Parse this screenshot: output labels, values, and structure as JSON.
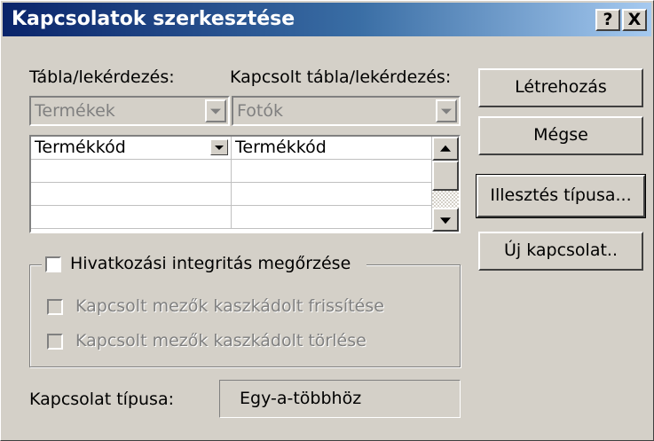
{
  "window": {
    "title": "Kapcsolatok szerkesztése",
    "help_button": "?",
    "close_button": "X"
  },
  "labels": {
    "table_query": "Tábla/lekérdezés:",
    "related_table_query": "Kapcsolt tábla/lekérdezés:",
    "relationship_type": "Kapcsolat típusa:"
  },
  "combos": {
    "table": {
      "value": "Termékek",
      "enabled": false
    },
    "related_table": {
      "value": "Fotók",
      "enabled": false
    }
  },
  "field_grid": {
    "rows": [
      {
        "field": "Termékkód",
        "related_field": "Termékkód"
      },
      {
        "field": "",
        "related_field": ""
      },
      {
        "field": "",
        "related_field": ""
      },
      {
        "field": "",
        "related_field": ""
      }
    ]
  },
  "buttons": {
    "create": "Létrehozás",
    "cancel": "Mégse",
    "join_type": "Illesztés típusa...",
    "new_relationship": "Új kapcsolat.."
  },
  "integrity": {
    "enforce_label": "Hivatkozási integritás megőrzése",
    "enforce_checked": false,
    "cascade_update_label": "Kapcsolt mezők kaszkádolt frissítése",
    "cascade_update_checked": false,
    "cascade_delete_label": "Kapcsolt mezők kaszkádolt törlése",
    "cascade_delete_checked": false
  },
  "relationship_type_value": "Egy-a-többhöz"
}
